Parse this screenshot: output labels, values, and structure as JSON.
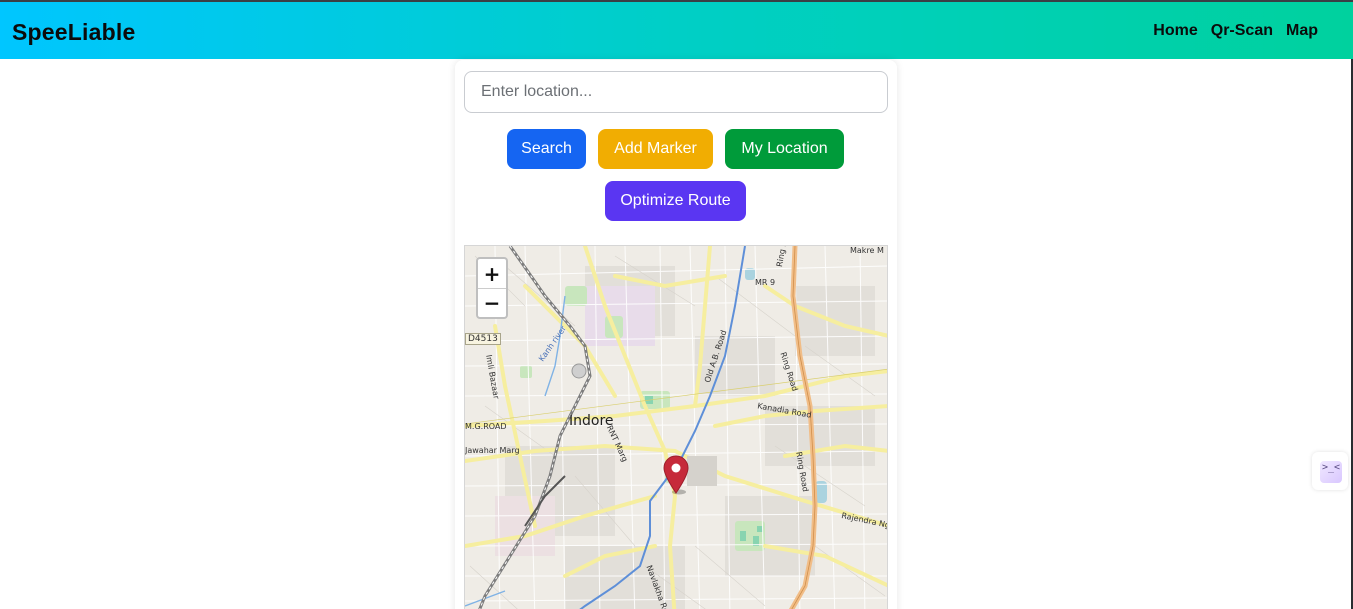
{
  "navbar": {
    "brand": "SpeeLiable",
    "links": [
      "Home",
      "Qr-Scan",
      "Map"
    ]
  },
  "search": {
    "placeholder": "Enter location...",
    "value": ""
  },
  "buttons": {
    "search": "Search",
    "add_marker": "Add Marker",
    "my_location": "My Location",
    "optimize_route": "Optimize Route"
  },
  "map": {
    "zoom_in": "+",
    "zoom_out": "−",
    "city": "Indore",
    "road_badge": "D4513",
    "labels": {
      "mr9": "MR 9",
      "ring_road_top": "Ring Road",
      "ring_road_mid": "Ring Road",
      "ring_road_low": "Ring Road",
      "kanadia": "Kanadia Road",
      "rajendra": "Rajendra Ng",
      "old_ab": "Old A.B. Road",
      "nehru": "RNT Marg",
      "jawahar": "Jawahar Marg",
      "imli": "Imli Bazaar",
      "navlakha": "Navlakha Rd",
      "mg_road": "M.G.ROAD",
      "khan_river": "Kanh river",
      "makre": "Makre M"
    }
  },
  "colors": {
    "brand_gradient_start": "#00c6ff",
    "brand_gradient_end": "#00d19e",
    "search_button": "#1565f2",
    "marker_button": "#f1ad02",
    "location_button": "#009b3a",
    "optimize_button": "#5a36f2",
    "map_pin": "#c62a3a"
  }
}
